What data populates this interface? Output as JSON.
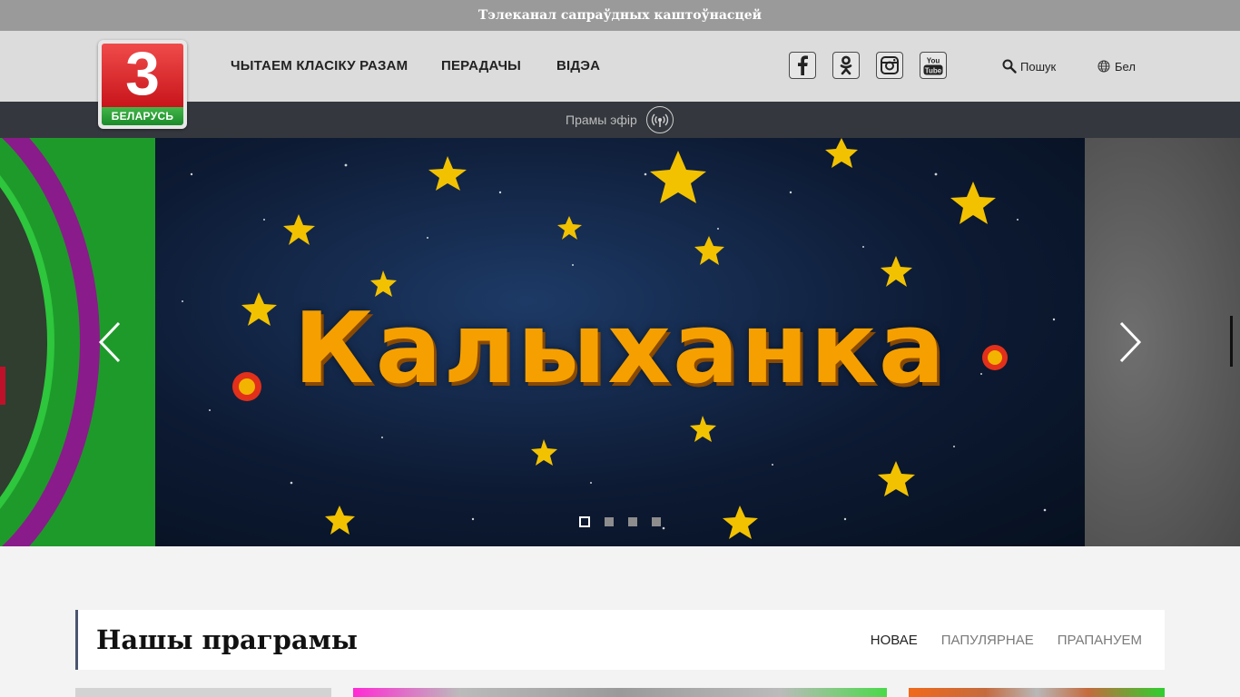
{
  "topbar": {
    "tagline": "Тэлеканал сапраўдных каштоўнасцей"
  },
  "logo": {
    "number": "3",
    "word": "БЕЛАРУСЬ",
    "colors": {
      "top": "#e0262c",
      "bottom": "#2a9d35"
    }
  },
  "nav": [
    {
      "label": "ЧЫТАЕМ КЛАСІКУ РАЗАМ"
    },
    {
      "label": "ПЕРАДАЧЫ"
    },
    {
      "label": "ВІДЭА"
    }
  ],
  "social": [
    {
      "icon": "facebook-icon"
    },
    {
      "icon": "odnoklassniki-icon"
    },
    {
      "icon": "instagram-icon"
    },
    {
      "icon": "youtube-icon",
      "text_top": "You",
      "text_bottom": "Tube"
    }
  ],
  "search": {
    "icon": "search-icon",
    "label": "Пошук"
  },
  "language": {
    "icon": "globe-icon",
    "label": "Бел"
  },
  "live": {
    "label": "Прамы эфір",
    "icon": "broadcast-icon"
  },
  "slider": {
    "title": "Калыханка",
    "slide_count": 4,
    "active_slide": 1,
    "prev_icon": "chevron-left-icon",
    "next_icon": "chevron-right-icon",
    "accent": "#f5a000"
  },
  "programs": {
    "title": "Нашы праграмы",
    "tabs": [
      {
        "label": "НОВАЕ",
        "active": true
      },
      {
        "label": "ПАПУЛЯРНАЕ",
        "active": false
      },
      {
        "label": "ПРАПАНУЕМ",
        "active": false
      }
    ]
  },
  "colors": {
    "topbar": "#9a9a9a",
    "header": "#dcdcdc",
    "livebar": "#34383e",
    "section_border": "#4a5670"
  }
}
